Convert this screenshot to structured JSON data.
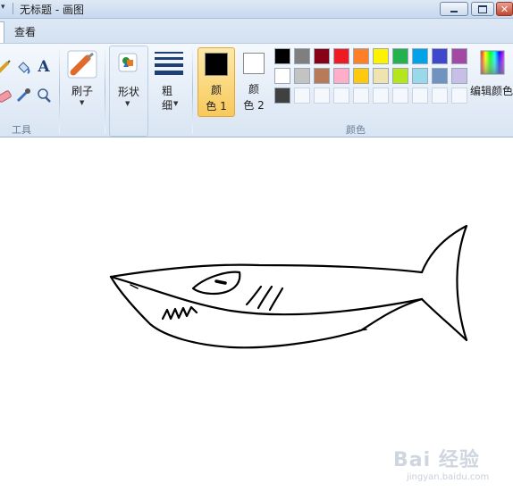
{
  "window": {
    "title": "无标题 - 画图",
    "quick_access_arrow": "▾",
    "close_glyph": "✕"
  },
  "tabs": {
    "view": "查看"
  },
  "groups": {
    "tools_label": "工具",
    "colors_label": "颜色"
  },
  "buttons": {
    "brush": "刷子",
    "shapes": "形状",
    "size_line1": "粗",
    "size_line2": "细",
    "color1_line1": "颜",
    "color1_line2": "色 1",
    "color2_line1": "颜",
    "color2_line2": "色 2",
    "edit_colors": "编辑颜色",
    "text_tool": "A"
  },
  "palette": {
    "color1": "#000000",
    "color2": "#ffffff",
    "row1": [
      "#000000",
      "#7f7f7f",
      "#880015",
      "#ed1c24",
      "#ff7f27",
      "#fff200",
      "#22b14c",
      "#00a2e8",
      "#3f48cc",
      "#a349a4"
    ],
    "row2": [
      "#ffffff",
      "#c3c3c3",
      "#b97a57",
      "#ffaec9",
      "#ffc90e",
      "#efe4b0",
      "#b5e61d",
      "#99d9ea",
      "#7092be",
      "#c8bfe7"
    ],
    "row3": [
      "#404040",
      "",
      "",
      "",
      "",
      "",
      "",
      "",
      "",
      ""
    ]
  },
  "watermark": {
    "brand": "Bai 经验",
    "url": "jingyan.baidu.com"
  }
}
